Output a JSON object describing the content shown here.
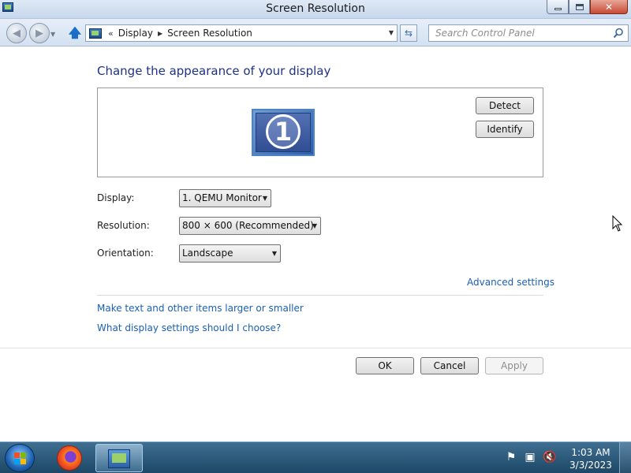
{
  "window": {
    "title": "Screen Resolution",
    "close_glyph": "✕"
  },
  "nav": {
    "breadcrumb_sep": "«",
    "breadcrumbs": [
      "Display",
      "Screen Resolution"
    ],
    "search_placeholder": "Search Control Panel"
  },
  "main": {
    "heading": "Change the appearance of your display",
    "monitor_number": "1",
    "detect_label": "Detect",
    "identify_label": "Identify",
    "fields": {
      "display_label": "Display:",
      "display_value": "1. QEMU Monitor",
      "resolution_label": "Resolution:",
      "resolution_value": "800 × 600 (Recommended)",
      "orientation_label": "Orientation:",
      "orientation_value": "Landscape"
    },
    "advanced_link": "Advanced settings",
    "larger_link": "Make text and other items larger or smaller",
    "choose_link": "What display settings should I choose?",
    "buttons": {
      "ok": "OK",
      "cancel": "Cancel",
      "apply": "Apply"
    }
  },
  "taskbar": {
    "time": "1:03 AM",
    "date": "3/3/2023"
  },
  "icons": [
    "control-panel-icon",
    "back-arrow-icon",
    "forward-arrow-icon",
    "up-arrow-icon",
    "refresh-icon",
    "search-icon",
    "monitor-icon",
    "start-orb-icon",
    "firefox-icon",
    "action-center-flag-icon",
    "network-icon",
    "volume-muted-icon"
  ],
  "colors": {
    "heading": "#1e3287",
    "link": "#1a5fb4",
    "taskbar": "#1d4866"
  }
}
